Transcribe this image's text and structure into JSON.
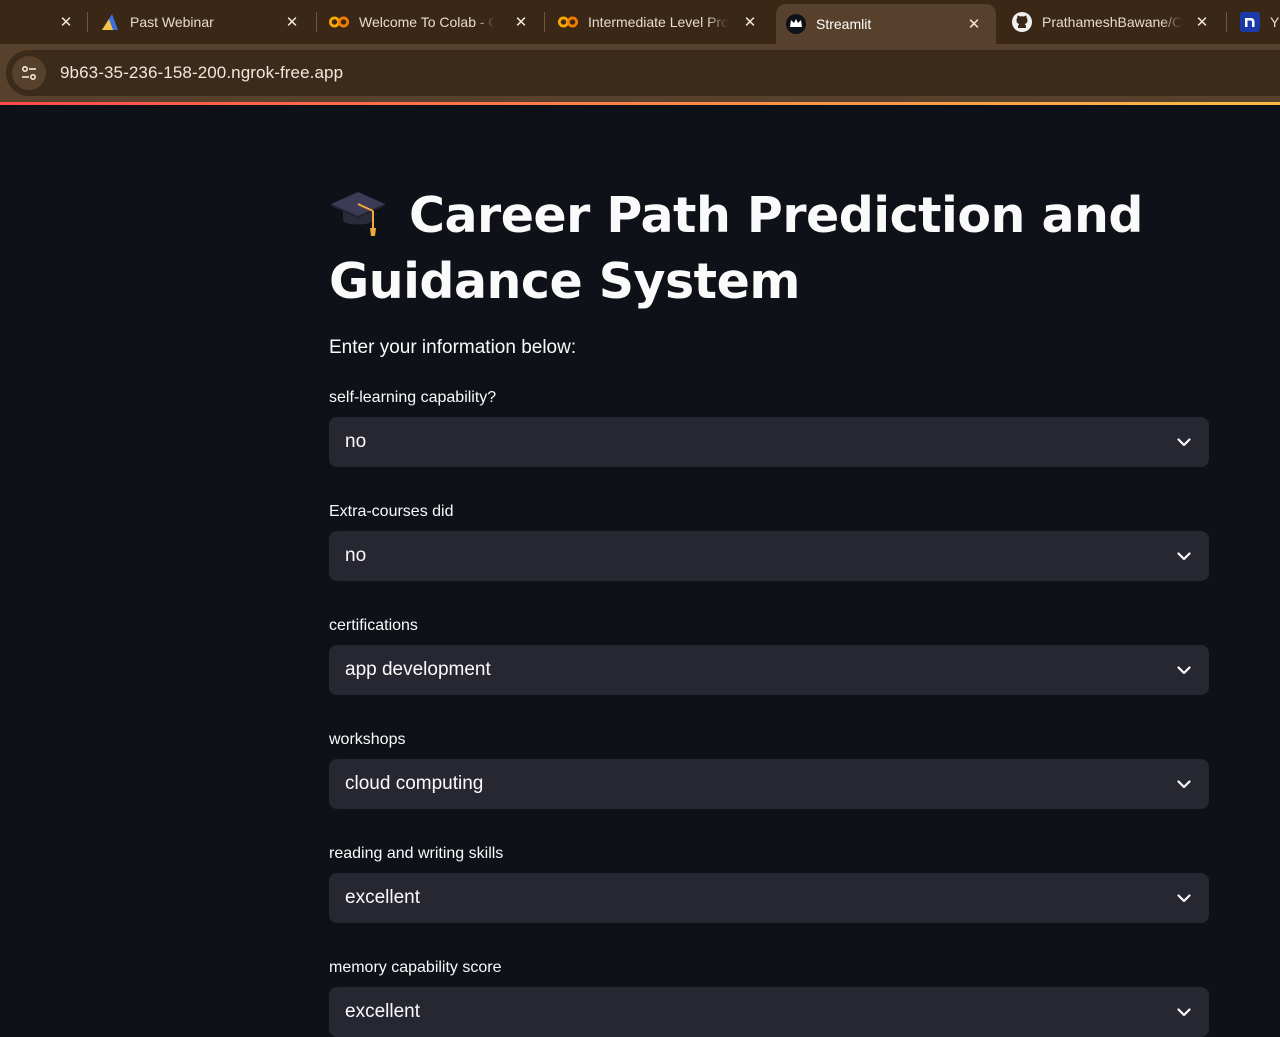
{
  "browser": {
    "tabs": [
      {
        "title": "Past Webinar",
        "icon": "gradient-triangle-icon"
      },
      {
        "title": "Welcome To Colab - Colab",
        "icon": "colab-icon"
      },
      {
        "title": "Intermediate Level Projects",
        "icon": "colab-icon"
      },
      {
        "title": "Streamlit",
        "icon": "streamlit-crown-icon",
        "active": true
      },
      {
        "title": "PrathameshBawane/Career",
        "icon": "github-icon"
      },
      {
        "title": "Y",
        "icon": "n-logo-icon"
      }
    ],
    "url": "9b63-35-236-158-200.ngrok-free.app"
  },
  "page": {
    "title": "Career Path Prediction and Guidance System",
    "title_emoji": "graduation-cap-icon",
    "intro": "Enter your information below:",
    "fields": [
      {
        "label": "self-learning capability?",
        "value": "no"
      },
      {
        "label": "Extra-courses did",
        "value": "no"
      },
      {
        "label": "certifications",
        "value": "app development"
      },
      {
        "label": "workshops",
        "value": "cloud computing"
      },
      {
        "label": "reading and writing skills",
        "value": "excellent"
      },
      {
        "label": "memory capability score",
        "value": "excellent"
      }
    ]
  },
  "colors": {
    "background": "#0e1117",
    "select_bg": "#262730",
    "chrome_tabbar": "#3a2716",
    "chrome_active": "#57412c",
    "accent_start": "#ff4b4b",
    "accent_end": "#ffbd45"
  }
}
